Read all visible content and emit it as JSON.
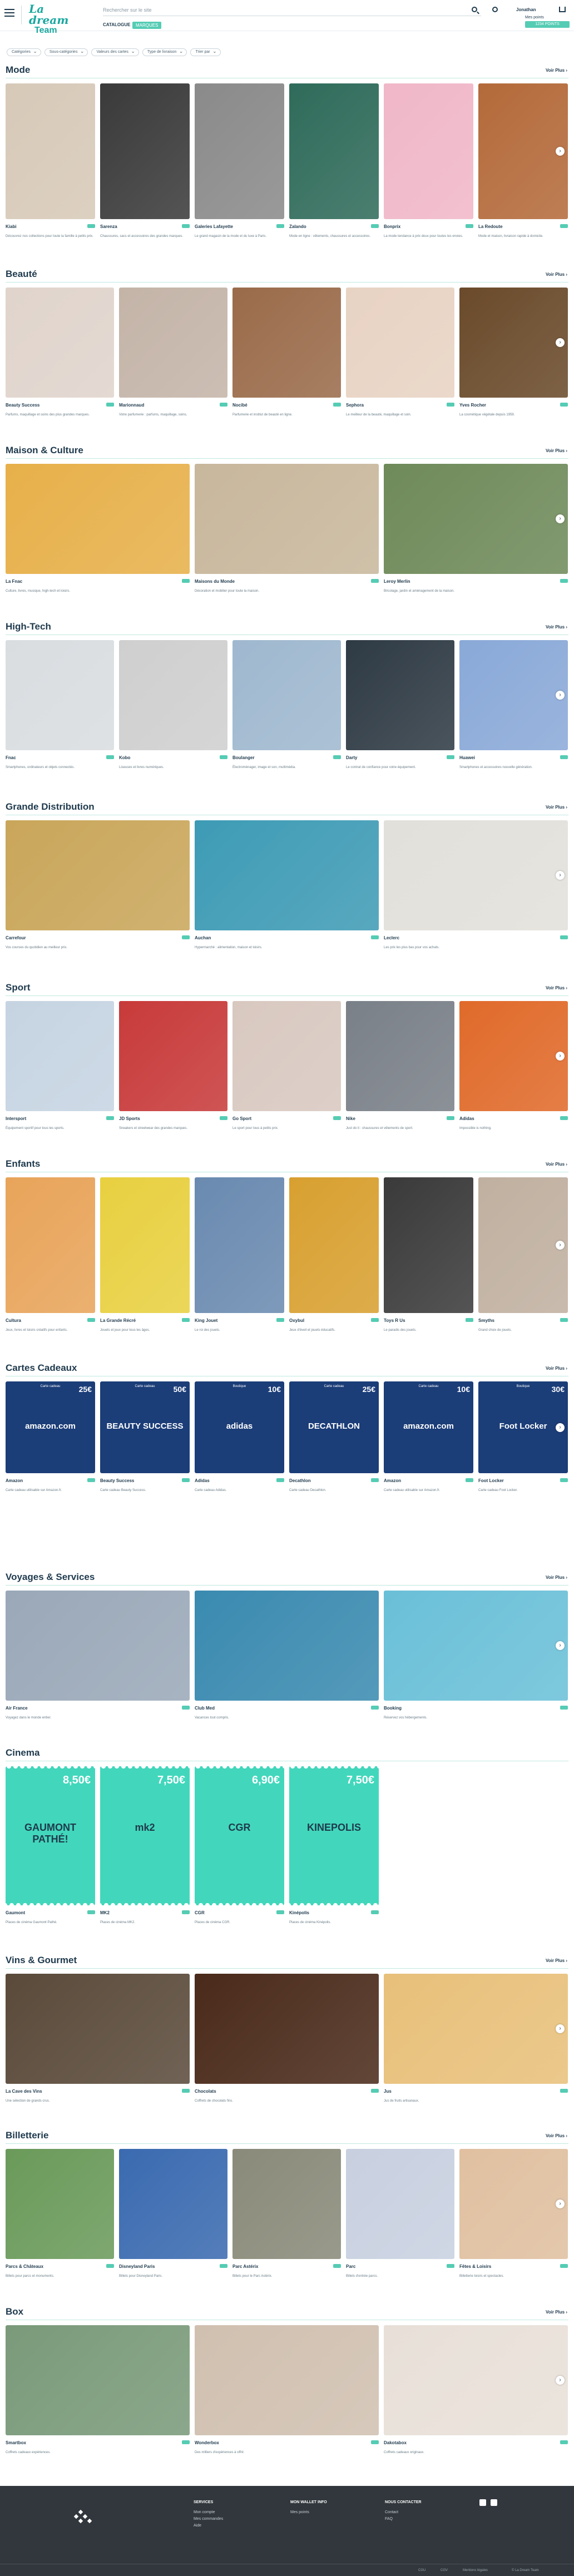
{
  "header": {
    "logo_line1": "La dream",
    "logo_line2": "Team",
    "search_placeholder": "Rechercher sur le site",
    "catalog_label": "CATALOGUE",
    "secondary_label": "MARQUES",
    "user_name": "Jonathan",
    "points_label": "Mes points",
    "badge_label": "1234 POINTS"
  },
  "filters": [
    "Catégories",
    "Sous-catégories",
    "Valeurs des cartes",
    "Type de livraison",
    "Trier par"
  ],
  "sections": [
    {
      "title": "Mode",
      "view_all": "Voir Plus",
      "cards": [
        {
          "name": "Kiabi",
          "desc": "Découvrez nos collections pour toute la famille à petits prix.",
          "color": "#d7c9b8"
        },
        {
          "name": "Sarenza",
          "desc": "Chaussures, sacs et accessoires des grandes marques.",
          "color": "#3a3a3a"
        },
        {
          "name": "Galeries Lafayette",
          "desc": "Le grand magasin de la mode et du luxe à Paris.",
          "color": "#8a8a8a"
        },
        {
          "name": "Zalando",
          "desc": "Mode en ligne : vêtements, chaussures et accessoires.",
          "color": "#2f6b5a"
        },
        {
          "name": "Bonprix",
          "desc": "La mode tendance à prix doux pour toutes les envies.",
          "color": "#f0b7c8"
        },
        {
          "name": "La Redoute",
          "desc": "Mode et maison, livraison rapide à domicile.",
          "color": "#b46a3a"
        }
      ]
    },
    {
      "title": "Beauté",
      "view_all": "Voir Plus",
      "cards": [
        {
          "name": "Beauty Success",
          "desc": "Parfums, maquillage et soins des plus grandes marques.",
          "color": "#e0d4cc"
        },
        {
          "name": "Marionnaud",
          "desc": "Votre parfumerie : parfums, maquillage, soins.",
          "color": "#c4b4a8"
        },
        {
          "name": "Nocibé",
          "desc": "Parfumerie et institut de beauté en ligne.",
          "color": "#9a6b4a"
        },
        {
          "name": "Sephora",
          "desc": "Le meilleur de la beauté, maquillage et soin.",
          "color": "#e8d3c3"
        },
        {
          "name": "Yves Rocher",
          "desc": "La cosmétique végétale depuis 1959.",
          "color": "#6a4a2a"
        }
      ]
    },
    {
      "title": "Maison & Culture",
      "view_all": "Voir Plus",
      "cards": [
        {
          "name": "La Fnac",
          "desc": "Culture, livres, musique, high-tech et loisirs.",
          "color": "#e7b04a"
        },
        {
          "name": "Maisons du Monde",
          "desc": "Décoration et mobilier pour toute la maison.",
          "color": "#c8b79c"
        },
        {
          "name": "Leroy Merlin",
          "desc": "Bricolage, jardin et aménagement de la maison.",
          "color": "#6f8a5a"
        }
      ]
    },
    {
      "title": "High-Tech",
      "view_all": "Voir Plus",
      "cards": [
        {
          "name": "Fnac",
          "desc": "Smartphones, ordinateurs et objets connectés.",
          "color": "#d9dde0"
        },
        {
          "name": "Kobo",
          "desc": "Liseuses et livres numériques.",
          "color": "#cfcfcf"
        },
        {
          "name": "Boulanger",
          "desc": "Électroménager, image et son, multimédia.",
          "color": "#9fb8cf"
        },
        {
          "name": "Darty",
          "desc": "Le contrat de confiance pour votre équipement.",
          "color": "#2e3a44"
        },
        {
          "name": "Huawei",
          "desc": "Smartphones et accessoires nouvelle génération.",
          "color": "#8aa9d8"
        }
      ]
    },
    {
      "title": "Grande Distribution",
      "view_all": "Voir Plus",
      "cards": [
        {
          "name": "Carrefour",
          "desc": "Vos courses du quotidien au meilleur prix.",
          "color": "#c9a65a"
        },
        {
          "name": "Auchan",
          "desc": "Hypermarché : alimentation, maison et loisirs.",
          "color": "#3e9bb5"
        },
        {
          "name": "Leclerc",
          "desc": "Les prix les plus bas pour vos achats.",
          "color": "#e2e0da"
        }
      ]
    },
    {
      "title": "Sport",
      "view_all": "Voir Plus",
      "cards": [
        {
          "name": "Intersport",
          "desc": "Équipement sportif pour tous les sports.",
          "color": "#c6d4e2"
        },
        {
          "name": "JD Sports",
          "desc": "Sneakers et streetwear des grandes marques.",
          "color": "#c83a3a"
        },
        {
          "name": "Go Sport",
          "desc": "Le sport pour tous à petits prix.",
          "color": "#d8c8c0"
        },
        {
          "name": "Nike",
          "desc": "Just do it : chaussures et vêtements de sport.",
          "color": "#7a8088"
        },
        {
          "name": "Adidas",
          "desc": "Impossible is nothing.",
          "color": "#e06a2a"
        }
      ]
    },
    {
      "title": "Enfants",
      "view_all": "Voir Plus",
      "cards": [
        {
          "name": "Cultura",
          "desc": "Jeux, livres et loisirs créatifs pour enfants.",
          "color": "#e8a45a"
        },
        {
          "name": "La Grande Récré",
          "desc": "Jouets et jeux pour tous les âges.",
          "color": "#e8d040"
        },
        {
          "name": "King Jouet",
          "desc": "Le roi des jouets.",
          "color": "#6a8ab0"
        },
        {
          "name": "Oxybul",
          "desc": "Jeux d'éveil et jouets éducatifs.",
          "color": "#d8a030"
        },
        {
          "name": "Toys R Us",
          "desc": "Le paradis des jouets.",
          "color": "#3a3a3a"
        },
        {
          "name": "Smyths",
          "desc": "Grand choix de jouets.",
          "color": "#c0b0a0"
        }
      ]
    },
    {
      "title": "Cartes Cadeaux",
      "view_all": "Voir Plus",
      "cards": [
        {
          "name": "Amazon",
          "desc": "Carte cadeau utilisable sur Amazon.fr.",
          "brand": "amazon.com",
          "value": "25€",
          "top": "Carte cadeau"
        },
        {
          "name": "Beauty Success",
          "desc": "Carte cadeau Beauty Success.",
          "brand": "BEAUTY SUCCESS",
          "value": "50€",
          "top": "Carte cadeau"
        },
        {
          "name": "Adidas",
          "desc": "Carte cadeau Adidas.",
          "brand": "adidas",
          "value": "10€",
          "top": "Boutique"
        },
        {
          "name": "Decathlon",
          "desc": "Carte cadeau Decathlon.",
          "brand": "DECATHLON",
          "value": "25€",
          "top": "Carte cadeau"
        },
        {
          "name": "Amazon",
          "desc": "Carte cadeau utilisable sur Amazon.fr.",
          "brand": "amazon.com",
          "value": "10€",
          "top": "Carte cadeau"
        },
        {
          "name": "Foot Locker",
          "desc": "Carte cadeau Foot Locker.",
          "brand": "Foot Locker",
          "value": "30€",
          "top": "Boutique"
        }
      ]
    },
    {
      "title": "Voyages & Services",
      "view_all": "Voir Plus",
      "cards": [
        {
          "name": "Air France",
          "desc": "Voyagez dans le monde entier.",
          "color": "#9aa8b8"
        },
        {
          "name": "Club Med",
          "desc": "Vacances tout compris.",
          "color": "#3a8ab0"
        },
        {
          "name": "Booking",
          "desc": "Réservez vos hébergements.",
          "color": "#6ac0d8"
        }
      ]
    },
    {
      "title": "Cinema",
      "view_all": "",
      "cards": [
        {
          "name": "Gaumont",
          "desc": "Places de cinéma Gaumont Pathé.",
          "brand": "GAUMONT PATHÉ!",
          "value": "8,50€"
        },
        {
          "name": "MK2",
          "desc": "Places de cinéma MK2.",
          "brand": "mk2",
          "value": "7,50€"
        },
        {
          "name": "CGR",
          "desc": "Places de cinéma CGR.",
          "brand": "CGR",
          "value": "6,90€"
        },
        {
          "name": "Kinépolis",
          "desc": "Places de cinéma Kinépolis.",
          "brand": "KINEPOLIS",
          "value": "7,50€"
        }
      ]
    },
    {
      "title": "Vins & Gourmet",
      "view_all": "Voir Plus",
      "cards": [
        {
          "name": "La Cave des Vins",
          "desc": "Une sélection de grands crus.",
          "color": "#5a4a3a"
        },
        {
          "name": "Chocolats",
          "desc": "Coffrets de chocolats fins.",
          "color": "#4a2a1a"
        },
        {
          "name": "Jus",
          "desc": "Jus de fruits artisanaux.",
          "color": "#e8c07a"
        }
      ]
    },
    {
      "title": "Billetterie",
      "view_all": "Voir Plus",
      "cards": [
        {
          "name": "Parcs & Châteaux",
          "desc": "Billets pour parcs et monuments.",
          "color": "#6a9a5a"
        },
        {
          "name": "Disneyland Paris",
          "desc": "Billets pour Disneyland Paris.",
          "color": "#3a6ab0"
        },
        {
          "name": "Parc Astérix",
          "desc": "Billets pour le Parc Astérix.",
          "color": "#8a8a7a"
        },
        {
          "name": "Parc",
          "desc": "Billets d'entrée parcs.",
          "color": "#c8d0e0"
        },
        {
          "name": "Fêtes & Loisirs",
          "desc": "Billetterie loisirs et spectacles.",
          "color": "#e0c0a0"
        }
      ]
    },
    {
      "title": "Box",
      "view_all": "Voir Plus",
      "cards": [
        {
          "name": "Smartbox",
          "desc": "Coffrets cadeaux expériences.",
          "color": "#7a9a7a"
        },
        {
          "name": "Wonderbox",
          "desc": "Des milliers d'expériences à offrir.",
          "color": "#d0c0b0"
        },
        {
          "name": "Dakotabox",
          "desc": "Coffrets cadeaux originaux.",
          "color": "#e8e0d8"
        }
      ]
    }
  ],
  "footer": {
    "col1_title": "SERVICES",
    "col1_items": [
      "Mon compte",
      "Mes commandes",
      "Aide"
    ],
    "col2_title": "MON WALLET INFO",
    "col2_items": [
      "Mes points"
    ],
    "col3_title": "NOUS CONTACTER",
    "col3_items": [
      "Contact",
      "FAQ"
    ],
    "bottom_items": [
      "CGU",
      "CGV",
      "Mentions légales",
      "© La Dream Team"
    ]
  }
}
